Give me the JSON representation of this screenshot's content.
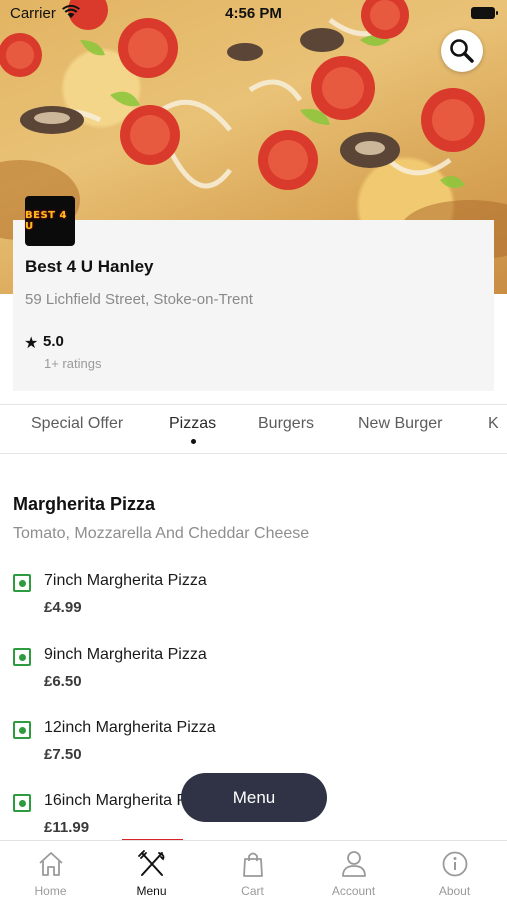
{
  "status_bar": {
    "carrier": "Carrier",
    "time": "4:56 PM"
  },
  "hero": {
    "image": "pizza-photo",
    "search_icon": "search-icon"
  },
  "restaurant": {
    "logo_text": "BEST 4 U",
    "name": "Best 4 U Hanley",
    "address": "59 Lichfield Street, Stoke-on-Trent",
    "rating_icon": "star-icon",
    "rating": "5.0",
    "rating_count": "1+ ratings"
  },
  "categories": {
    "active": "Pizzas",
    "items": [
      {
        "label": "Special Offer"
      },
      {
        "label": "Pizzas"
      },
      {
        "label": "Burgers"
      },
      {
        "label": "New Burger"
      },
      {
        "label": "K"
      }
    ]
  },
  "section": {
    "title": "Margherita Pizza",
    "description": "Tomato, Mozzarella And Cheddar Cheese",
    "items": [
      {
        "name": "7inch Margherita Pizza",
        "price": "£4.99"
      },
      {
        "name": "9inch Margherita Pizza",
        "price": "£6.50"
      },
      {
        "name": "12inch Margherita Pizza",
        "price": "£7.50"
      },
      {
        "name": "16inch Margherita Pizza",
        "price": "£11.99"
      }
    ]
  },
  "floating_button": {
    "label": "Menu"
  },
  "tab_bar": {
    "active": "Menu",
    "items": [
      {
        "label": "Home",
        "icon": "home-icon"
      },
      {
        "label": "Menu",
        "icon": "fork-knife-icon"
      },
      {
        "label": "Cart",
        "icon": "bag-icon"
      },
      {
        "label": "Account",
        "icon": "user-icon"
      },
      {
        "label": "About",
        "icon": "info-icon"
      }
    ]
  },
  "colors": {
    "accent": "#d8252b",
    "veg": "#2e9b3e",
    "pill": "#2f3345",
    "card_bg": "#f5f5f5"
  }
}
